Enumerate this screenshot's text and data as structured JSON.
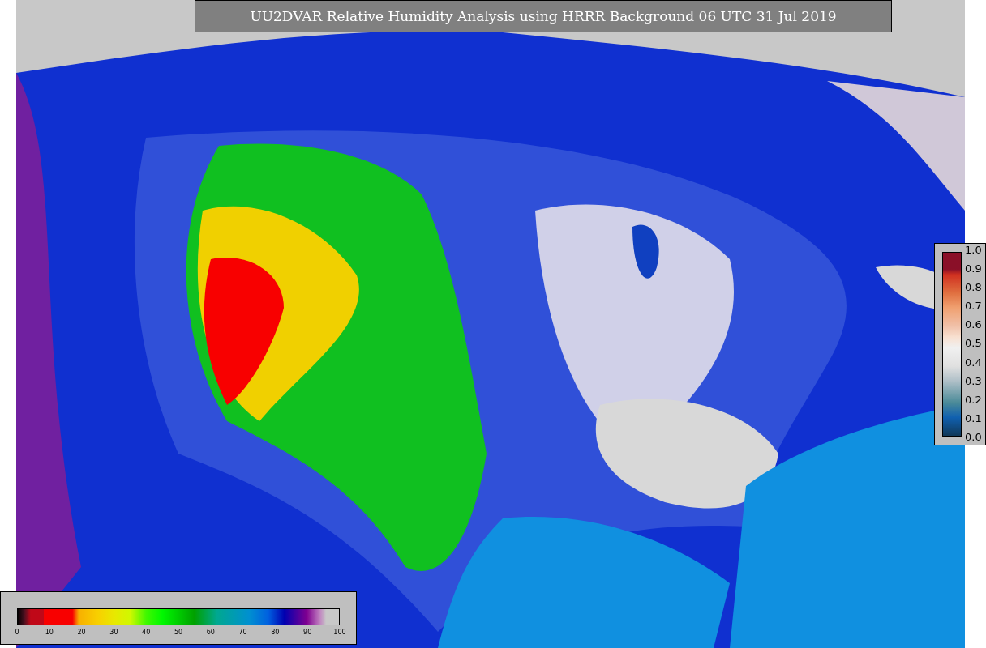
{
  "title": "UU2DVAR Relative Humidity Analysis using HRRR Background 06 UTC 31 Jul 2019",
  "humidity_colorbar": {
    "ticks": [
      "0",
      "10",
      "20",
      "30",
      "40",
      "50",
      "60",
      "70",
      "80",
      "90",
      "100"
    ]
  },
  "weight_colorbar": {
    "ticks": [
      "1.0",
      "0.9",
      "0.8",
      "0.7",
      "0.6",
      "0.5",
      "0.4",
      "0.3",
      "0.2",
      "0.1",
      "0.0"
    ]
  }
}
